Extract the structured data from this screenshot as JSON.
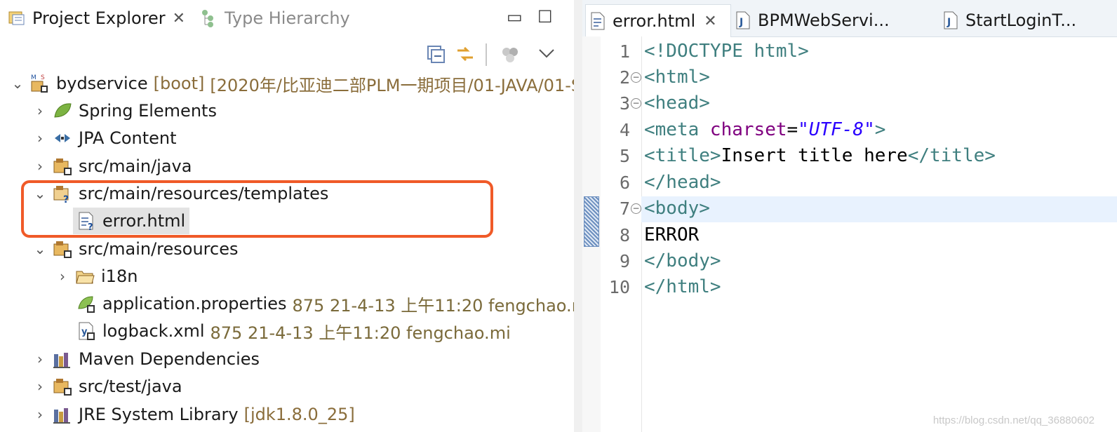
{
  "left_tabs": {
    "project_explorer": "Project Explorer",
    "type_hierarchy": "Type Hierarchy"
  },
  "tree": {
    "root": {
      "name": "bydservice",
      "tag": "[boot]",
      "path": "[2020年/比亚迪二部PLM一期项目/01-JAVA/01-S"
    },
    "items": [
      {
        "label": "Spring Elements",
        "icon": "spring-leaf-icon"
      },
      {
        "label": "JPA Content",
        "icon": "jpa-icon"
      },
      {
        "label": "src/main/java",
        "icon": "package-folder-icon"
      },
      {
        "label": "src/main/resources/templates",
        "icon": "source-folder-icon"
      },
      {
        "label": "error.html",
        "icon": "html-file-icon"
      },
      {
        "label": "src/main/resources",
        "icon": "package-folder-icon"
      },
      {
        "label": "i18n",
        "icon": "folder-icon"
      },
      {
        "label": "application.properties",
        "meta": "875  21-4-13 上午11:20  fengchao.m",
        "icon": "properties-file-icon"
      },
      {
        "label": "logback.xml",
        "meta": "875  21-4-13 上午11:20  fengchao.mi",
        "icon": "xml-file-icon"
      },
      {
        "label": "Maven Dependencies",
        "icon": "library-icon"
      },
      {
        "label": "src/test/java",
        "icon": "package-folder-icon"
      },
      {
        "label": "JRE System Library",
        "meta": "[jdk1.8.0_25]",
        "icon": "library-icon"
      }
    ]
  },
  "editor_tabs": [
    {
      "label": "error.html",
      "active": true
    },
    {
      "label": "BPMWebServi...",
      "active": false
    },
    {
      "label": "StartLoginT...",
      "active": false
    }
  ],
  "editor": {
    "line_numbers": [
      "1",
      "2",
      "3",
      "4",
      "5",
      "6",
      "7",
      "8",
      "9",
      "10"
    ],
    "lines": [
      [
        {
          "c": "tag",
          "t": "<!DOCTYPE html>"
        }
      ],
      [
        {
          "c": "tag",
          "t": "<html>"
        }
      ],
      [
        {
          "c": "tag",
          "t": "<head>"
        }
      ],
      [
        {
          "c": "tag",
          "t": "<meta "
        },
        {
          "c": "attr",
          "t": "charset"
        },
        {
          "c": "txt",
          "t": "="
        },
        {
          "c": "val",
          "t": "\"UTF-8\""
        },
        {
          "c": "tag",
          "t": ">"
        }
      ],
      [
        {
          "c": "tag",
          "t": "<title>"
        },
        {
          "c": "txt",
          "t": "Insert title here"
        },
        {
          "c": "tag",
          "t": "</title>"
        }
      ],
      [
        {
          "c": "tag",
          "t": "</head>"
        }
      ],
      [
        {
          "c": "tag",
          "t": "<body>"
        }
      ],
      [
        {
          "c": "txt",
          "t": "ERROR"
        }
      ],
      [
        {
          "c": "tag",
          "t": "</body>"
        }
      ],
      [
        {
          "c": "tag",
          "t": "</html>"
        }
      ]
    ]
  },
  "watermark": "https://blog.csdn.net/qq_36880602"
}
